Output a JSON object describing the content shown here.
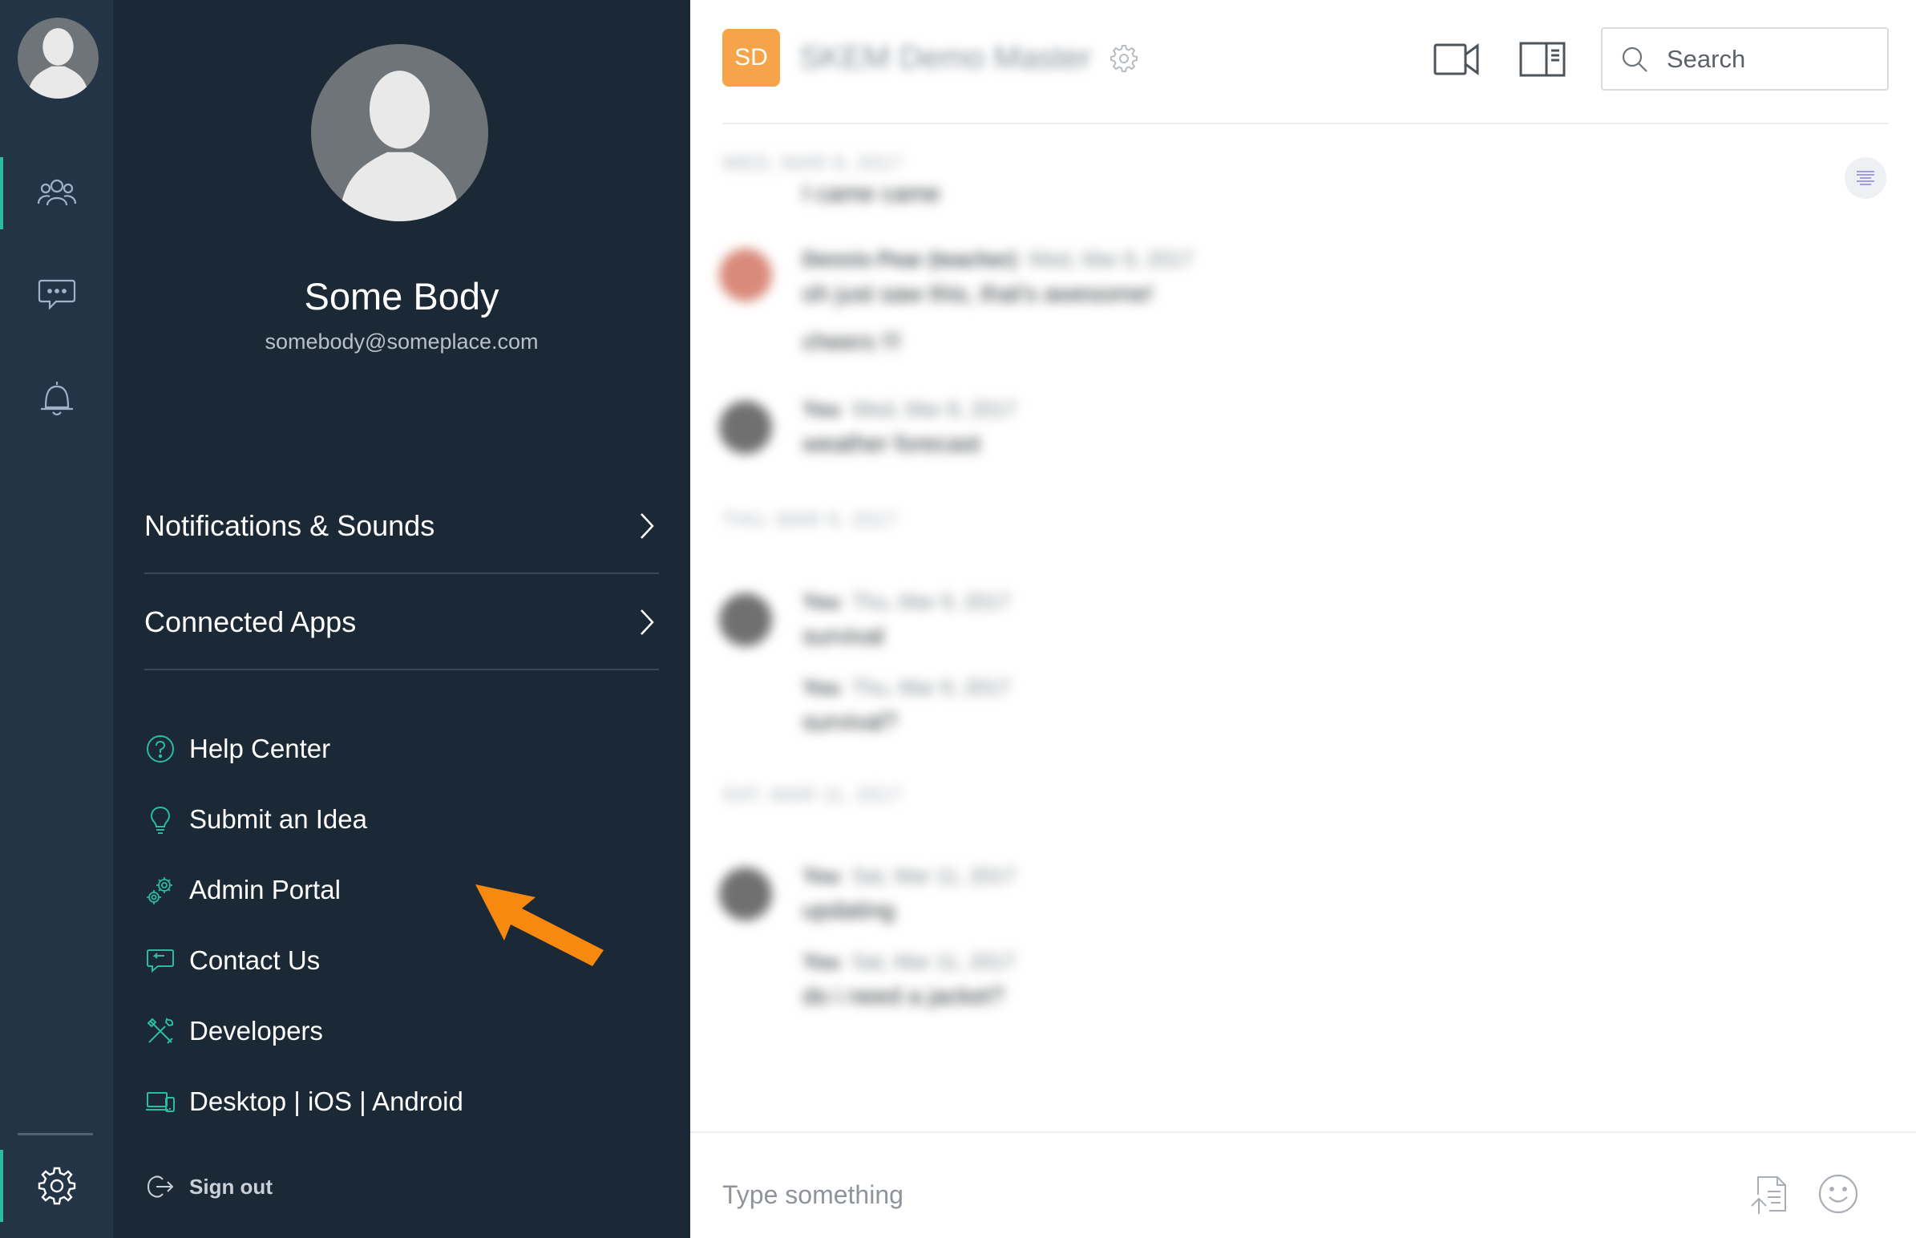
{
  "rail": {
    "items": [
      {
        "name": "team",
        "icon": "people-icon",
        "active": true
      },
      {
        "name": "messages",
        "icon": "chat-bubble-icon",
        "active": false
      },
      {
        "name": "notifications",
        "icon": "bell-icon",
        "active": false
      }
    ],
    "settings_icon": "gear-icon"
  },
  "profile": {
    "name": "Some Body",
    "email": "somebody@someplace.com"
  },
  "settings_menu": [
    {
      "label": "Notifications & Sounds"
    },
    {
      "label": "Connected Apps"
    }
  ],
  "links": [
    {
      "label": "Help Center",
      "icon": "question-circle-icon"
    },
    {
      "label": "Submit an Idea",
      "icon": "lightbulb-icon"
    },
    {
      "label": "Admin Portal",
      "icon": "gears-icon"
    },
    {
      "label": "Contact Us",
      "icon": "speech-bubble-icon"
    },
    {
      "label": "Developers",
      "icon": "tools-icon"
    },
    {
      "label": "Desktop | iOS | Android",
      "icon": "devices-icon"
    }
  ],
  "sign_out": {
    "label": "Sign out",
    "icon": "sign-out-icon"
  },
  "conversation": {
    "badge": "SD",
    "title": "SKEM Demo Master",
    "search_placeholder": "Search",
    "composer_placeholder": "Type something"
  },
  "messages": {
    "days": [
      "WED, MAR 8, 2017",
      "THU, MAR 9, 2017",
      "SAT, MAR 11, 2017"
    ],
    "entries": [
      {
        "author": "",
        "time": "",
        "text": "I came came"
      },
      {
        "author": "Dennis Pear (teacher)",
        "time": "Wed, Mar 8, 2017",
        "text": "oh just saw this, that's awesome!"
      },
      {
        "author": "",
        "time": "",
        "text": "cheers !!!"
      },
      {
        "author": "You",
        "time": "Wed, Mar 8, 2017",
        "text": "weather forecast"
      },
      {
        "author": "You",
        "time": "Thu, Mar 9, 2017",
        "text": "survival"
      },
      {
        "author": "You",
        "time": "Thu, Mar 9, 2017",
        "text": "survival?"
      },
      {
        "author": "You",
        "time": "Sat, Mar 11, 2017",
        "text": "updating"
      },
      {
        "author": "You",
        "time": "Sat, Mar 11, 2017",
        "text": "do i need a jacket?"
      }
    ]
  },
  "colors": {
    "rail_bg": "#233446",
    "panel_bg": "#1b2835",
    "accent_teal": "#2bbba1",
    "badge_orange": "#f7a34a",
    "arrow_orange": "#f7890f"
  }
}
